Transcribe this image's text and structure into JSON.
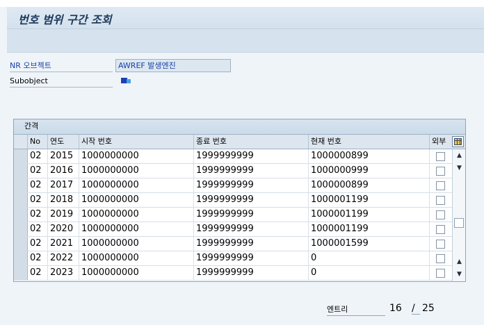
{
  "window": {
    "title": "번호 범위 구간 조회"
  },
  "form": {
    "nr_object_label": "NR 오브젝트",
    "nr_object_value": "AWREF 발생엔진",
    "subobject_label": "Subobject"
  },
  "table": {
    "title": "간격",
    "headers": {
      "no": "No",
      "year": "연도",
      "start": "시작 번호",
      "end": "종료 번호",
      "current": "현재 번호",
      "external": "외부"
    },
    "rows": [
      {
        "no": "02",
        "year": "2015",
        "start": "1000000000",
        "end": "1999999999",
        "current": "1000000899"
      },
      {
        "no": "02",
        "year": "2016",
        "start": "1000000000",
        "end": "1999999999",
        "current": "1000000999"
      },
      {
        "no": "02",
        "year": "2017",
        "start": "1000000000",
        "end": "1999999999",
        "current": "1000000899"
      },
      {
        "no": "02",
        "year": "2018",
        "start": "1000000000",
        "end": "1999999999",
        "current": "1000001199"
      },
      {
        "no": "02",
        "year": "2019",
        "start": "1000000000",
        "end": "1999999999",
        "current": "1000001199"
      },
      {
        "no": "02",
        "year": "2020",
        "start": "1000000000",
        "end": "1999999999",
        "current": "1000001199"
      },
      {
        "no": "02",
        "year": "2021",
        "start": "1000000000",
        "end": "1999999999",
        "current": "1000001599"
      },
      {
        "no": "02",
        "year": "2022",
        "start": "1000000000",
        "end": "1999999999",
        "current": "0"
      },
      {
        "no": "02",
        "year": "2023",
        "start": "1000000000",
        "end": "1999999999",
        "current": "0"
      }
    ]
  },
  "footer": {
    "entry_label": "엔트리",
    "current": "16",
    "separator": "/",
    "total": "25"
  },
  "icons": {
    "subobject": "subobject-icon",
    "table_settings": "table-settings-icon"
  }
}
